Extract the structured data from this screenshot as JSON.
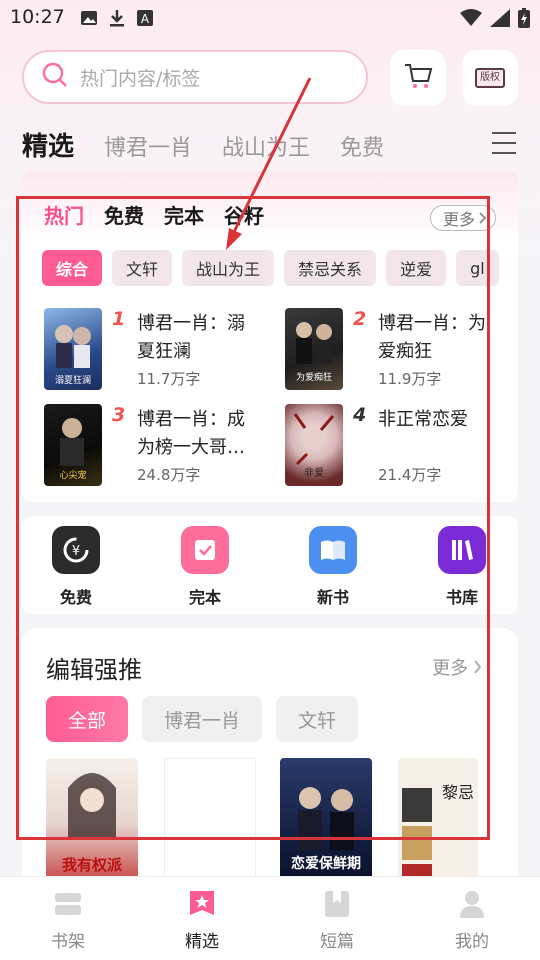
{
  "status_bar": {
    "time": "10:27"
  },
  "search": {
    "placeholder": "热门内容/标签"
  },
  "header": {
    "rights_label": "版权"
  },
  "top_tabs": [
    "精选",
    "博君一肖",
    "战山为王",
    "免费"
  ],
  "hot": {
    "tabs": [
      "热门",
      "免费",
      "完本",
      "谷籽"
    ],
    "more_label": "更多",
    "chips": [
      "综合",
      "文轩",
      "战山为王",
      "禁忌关系",
      "逆爱",
      "gl"
    ],
    "items": [
      {
        "rank": "1",
        "title": "博君一肖：溺夏狂澜",
        "words": "11.7万字",
        "cover_text": "溺夏狂澜"
      },
      {
        "rank": "2",
        "title": "博君一肖：为爱痴狂",
        "words": "11.9万字",
        "cover_text": "为爱痴狂"
      },
      {
        "rank": "3",
        "title": "博君一肖：成为榜一大哥…",
        "words": "24.8万字",
        "cover_text": "心尖宠"
      },
      {
        "rank": "4",
        "title": "非正常恋爱",
        "words": "21.4万字",
        "cover_text": "非爱"
      }
    ],
    "rank_colors": {
      "top": "#f0524f",
      "other": "#333333"
    }
  },
  "grid": [
    {
      "label": "免费",
      "icon": "yuan-icon",
      "color": "#2b2b2b"
    },
    {
      "label": "完本",
      "icon": "check-book-icon",
      "color": "#ff6d9a"
    },
    {
      "label": "新书",
      "icon": "open-book-icon",
      "color": "#4c8ff0"
    },
    {
      "label": "书库",
      "icon": "library-icon",
      "color": "#7a2bd6"
    }
  ],
  "editor": {
    "title": "编辑强推",
    "more_label": "更多",
    "chips": [
      "全部",
      "博君一肖",
      "文轩"
    ],
    "covers": [
      {
        "text": "我有权派"
      },
      {
        "text": ""
      },
      {
        "text": "恋爱保鲜期"
      },
      {
        "text": "黎忌"
      }
    ]
  },
  "bottom_nav": [
    "书架",
    "精选",
    "短篇",
    "我的"
  ],
  "accent": "#ff5b93"
}
